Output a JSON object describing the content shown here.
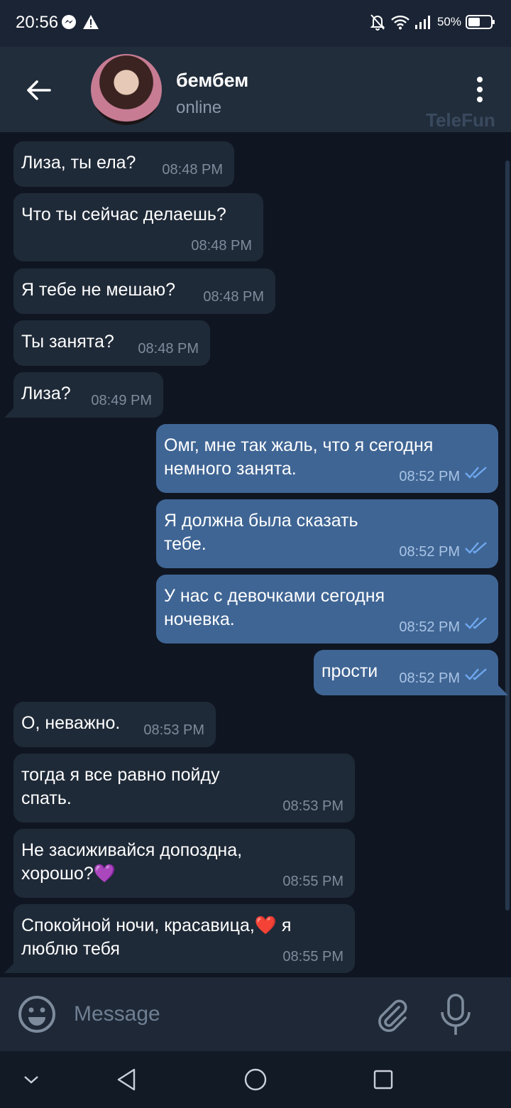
{
  "status_bar": {
    "time": "20:56",
    "battery": "50%",
    "icons": [
      "messenger-icon",
      "warning-icon",
      "bell-off-icon",
      "wifi-icon",
      "signal-icon",
      "battery-icon"
    ]
  },
  "header": {
    "name": "бембем",
    "status": "online",
    "watermark": "TeleFun",
    "icons": [
      "back-arrow-icon",
      "more-vertical-icon"
    ]
  },
  "messages": [
    {
      "dir": "in",
      "text": "Лиза, ты ела?",
      "time": "08:48 PM"
    },
    {
      "dir": "in",
      "text": "Что ты сейчас делаешь?",
      "time": "08:48 PM"
    },
    {
      "dir": "in",
      "text": "Я тебе не мешаю?",
      "time": "08:48 PM"
    },
    {
      "dir": "in",
      "text": "Ты занята?",
      "time": "08:48 PM"
    },
    {
      "dir": "in",
      "text": "Лиза?",
      "time": "08:49 PM"
    },
    {
      "dir": "out",
      "text": "Омг, мне так жаль, что я сегодня\nнемного занята.",
      "time": "08:52 PM"
    },
    {
      "dir": "out",
      "text": "Я должна была сказать\nтебе.",
      "time": "08:52 PM"
    },
    {
      "dir": "out",
      "text": "У нас с девочками сегодня\nночевка.",
      "time": "08:52 PM"
    },
    {
      "dir": "out",
      "text": "прости",
      "time": "08:52 PM"
    },
    {
      "dir": "in",
      "text": "О, неважно.",
      "time": "08:53 PM"
    },
    {
      "dir": "in",
      "text": "тогда я все равно пойду\nспать.",
      "time": "08:53 PM"
    },
    {
      "dir": "in",
      "text": "Не засиживайся допоздна,\nхорошо?💜",
      "time": "08:55 PM"
    },
    {
      "dir": "in",
      "text": "Спокойной ночи, красавица,❤️ я\nлюблю тебя",
      "time": "08:55 PM"
    }
  ],
  "input": {
    "placeholder": "Message",
    "icons": [
      "emoji-icon",
      "paperclip-icon",
      "microphone-icon"
    ]
  },
  "nav": {
    "icons": [
      "chevron-down-icon",
      "back-triangle-icon",
      "home-circle-icon",
      "recents-square-icon"
    ]
  },
  "colors": {
    "background": "#0f1622",
    "header": "#212d3b",
    "incoming_bubble": "#1f2a38",
    "outgoing_bubble": "#3f6594",
    "read_check": "#6fa8ef"
  }
}
